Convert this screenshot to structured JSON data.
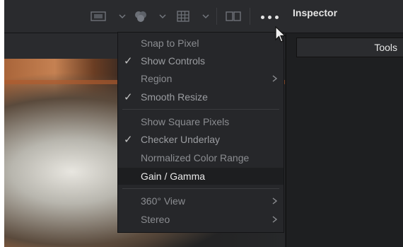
{
  "panel_title": "Inspector",
  "tools_tab": "Tools",
  "menu": {
    "items": [
      {
        "label": "Snap to Pixel",
        "checked": false,
        "submenu": false
      },
      {
        "label": "Show Controls",
        "checked": true,
        "submenu": false
      },
      {
        "label": "Region",
        "checked": false,
        "submenu": true
      },
      {
        "label": "Smooth Resize",
        "checked": true,
        "submenu": false
      },
      {
        "label": "Show Square Pixels",
        "checked": false,
        "submenu": false
      },
      {
        "label": "Checker Underlay",
        "checked": true,
        "submenu": false
      },
      {
        "label": "Normalized Color Range",
        "checked": false,
        "submenu": false
      },
      {
        "label": "Gain / Gamma",
        "checked": false,
        "submenu": false,
        "highlighted": true
      },
      {
        "label": "360° View",
        "checked": false,
        "submenu": true
      },
      {
        "label": "Stereo",
        "checked": false,
        "submenu": true
      }
    ],
    "check_glyph": "✓"
  },
  "colors": {
    "toolbar": "#2a2b2e",
    "menu_bg": "#26272a",
    "menu_highlight": "#1d1e20",
    "text_dim": "#8b8d91",
    "text_bright": "#e8e8e8"
  },
  "icons": {
    "toolbar": [
      "viewer-lut-icon",
      "chevron-down-icon",
      "color-channels-icon",
      "chevron-down-icon",
      "grid-icon",
      "chevron-down-icon",
      "split-view-icon",
      "more-options-icon"
    ]
  }
}
